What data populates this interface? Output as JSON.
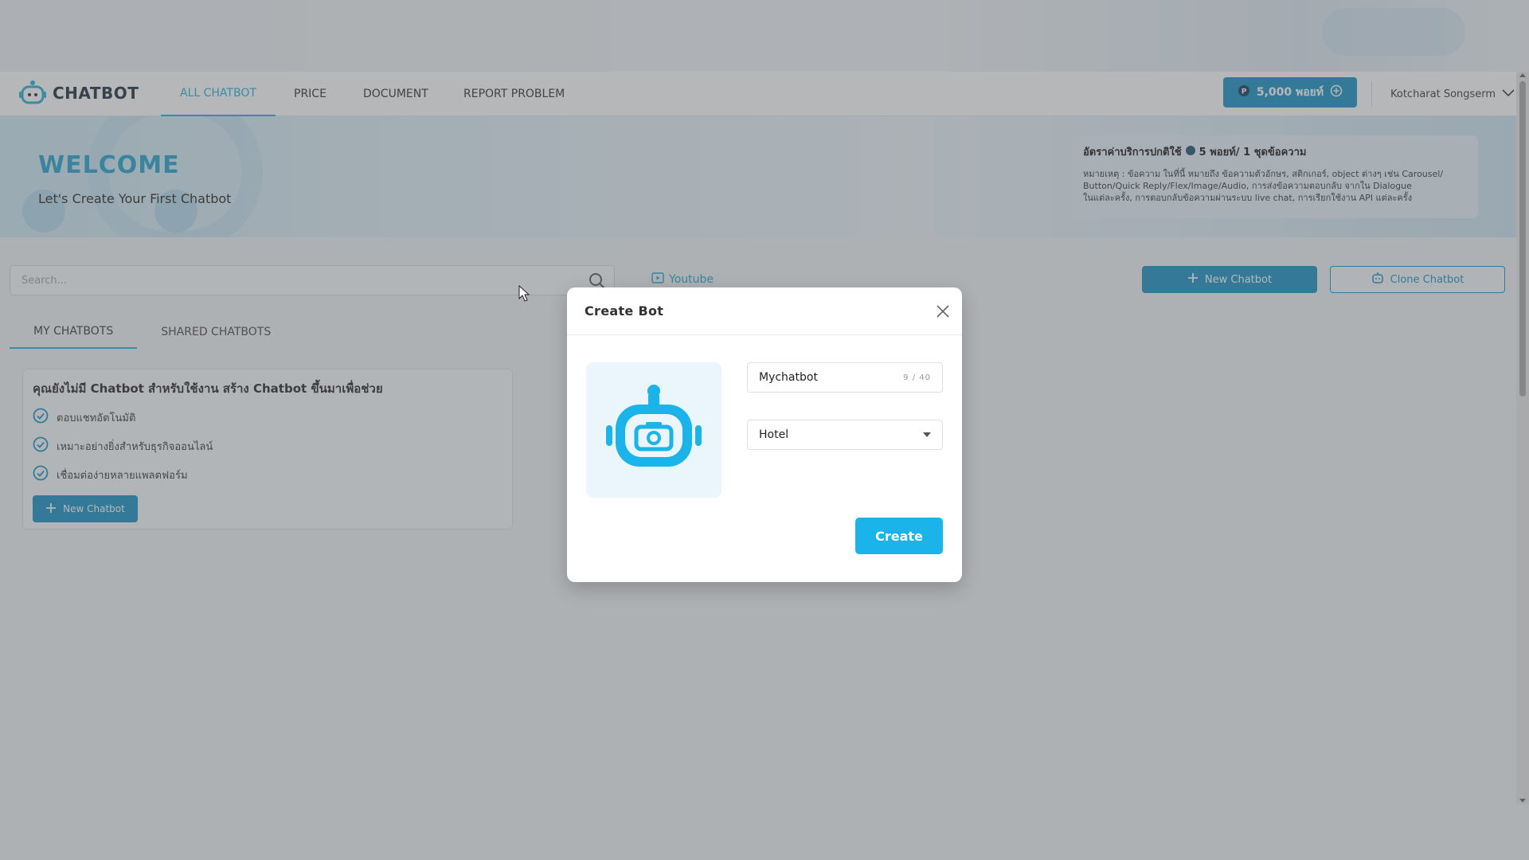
{
  "app": {
    "logo_text": "CHATBOT",
    "nav": {
      "items": [
        {
          "label": "ALL CHATBOT",
          "active": true
        },
        {
          "label": "PRICE"
        },
        {
          "label": "DOCUMENT"
        },
        {
          "label": "REPORT PROBLEM"
        }
      ],
      "points_label": "5,000 พอยท์",
      "user_name": "Kotcharat Songserm"
    }
  },
  "banner": {
    "welcome": "WELCOME",
    "subtitle": "Let's Create Your First Chatbot",
    "rate_title_prefix": "อัตราค่าบริการปกติใช้",
    "rate_title_suffix": "5 พอยท์/ 1 ชุดข้อความ",
    "rate_note_1": "หมายเหตุ : ข้อความ ในที่นี้ หมายถึง ข้อความตัวอักษร, สติกเกอร์, object ต่างๆ เช่น Carousel/",
    "rate_note_2": "Button/Quick Reply/Flex/Image/Audio, การส่งข้อความตอบกลับ จากใน Dialogue",
    "rate_note_3": "ในแต่ละครั้ง, การตอบกลับข้อความผ่านระบบ live chat, การเรียกใช้งาน API แต่ละครั้ง"
  },
  "toolbar": {
    "search_placeholder": "Search...",
    "youtube_label": "Youtube",
    "new_chatbot_label": "New Chatbot",
    "clone_chatbot_label": "Clone Chatbot"
  },
  "tabs": [
    {
      "label": "MY CHATBOTS",
      "active": true
    },
    {
      "label": "SHARED CHATBOTS"
    }
  ],
  "empty_state": {
    "title": "คุณยังไม่มี Chatbot สำหรับใช้งาน สร้าง Chatbot ขึ้นมาเพื่อช่วย",
    "features": [
      "ตอบแชทอัตโนมัติ",
      "เหมาะอย่างยิ่งสำหรับธุรกิจออนไลน์",
      "เชื่อมต่อง่ายหลายแพลตฟอร์ม"
    ],
    "button_label": "New Chatbot"
  },
  "modal": {
    "title": "Create Bot",
    "name_value": "Mychatbot",
    "name_counter": "9 / 40",
    "type_value": "Hotel",
    "create_label": "Create"
  },
  "colors": {
    "accent": "#1fb0d8",
    "primary_button": "#1590c4",
    "create_button": "#1ab4ea"
  }
}
